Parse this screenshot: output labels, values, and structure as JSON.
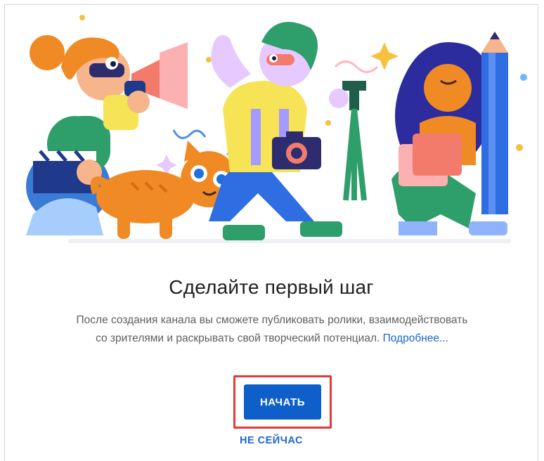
{
  "dialog": {
    "title": "Сделайте первый шаг",
    "description": "После создания канала вы сможете публиковать ролики, взаимодействовать со зрителями и раскрывать свой творческий потенциал.",
    "learn_more_link": "Подробнее...",
    "start_button": "НАЧАТЬ",
    "not_now_button": "НЕ СЕЙЧАС"
  },
  "colors": {
    "primary_button": "#0e5fc9",
    "link": "#1a66d3",
    "highlight_frame": "#e53935"
  },
  "illustration": {
    "icons": [
      "megaphone-icon",
      "camera-icon",
      "pencil-icon",
      "tripod-icon",
      "cat-icon",
      "clapperboard-icon"
    ]
  }
}
